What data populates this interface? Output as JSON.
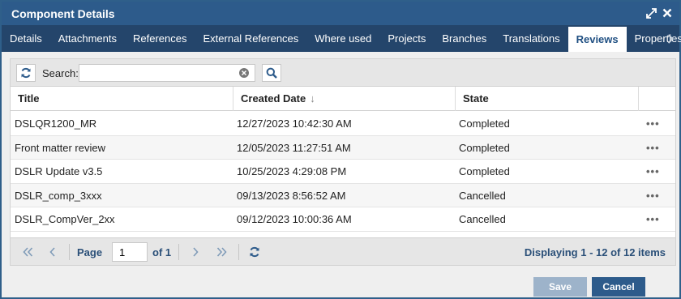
{
  "dialog": {
    "title": "Component Details"
  },
  "tabs": [
    {
      "label": "Details"
    },
    {
      "label": "Attachments"
    },
    {
      "label": "References"
    },
    {
      "label": "External References"
    },
    {
      "label": "Where used"
    },
    {
      "label": "Projects"
    },
    {
      "label": "Branches"
    },
    {
      "label": "Translations"
    },
    {
      "label": "Reviews",
      "active": true
    },
    {
      "label": "Properties"
    }
  ],
  "search": {
    "label": "Search:",
    "value": "",
    "placeholder": ""
  },
  "grid": {
    "columns": [
      "Title",
      "Created Date",
      "State",
      ""
    ],
    "sort_indicator": "↓",
    "rows": [
      {
        "title": "DSLQR1200_MR",
        "created": "12/27/2023 10:42:30 AM",
        "state": "Completed",
        "actions": "•••"
      },
      {
        "title": "Front matter review",
        "created": "12/05/2023 11:27:51 AM",
        "state": "Completed",
        "actions": "•••"
      },
      {
        "title": "DSLR Update v3.5",
        "created": "10/25/2023 4:29:08 PM",
        "state": "Completed",
        "actions": "•••"
      },
      {
        "title": "DSLR_comp_3xxx",
        "created": "09/13/2023 8:56:52 AM",
        "state": "Cancelled",
        "actions": "•••"
      },
      {
        "title": "DSLR_CompVer_2xx",
        "created": "09/12/2023 10:00:36 AM",
        "state": "Cancelled",
        "actions": "•••"
      }
    ]
  },
  "pager": {
    "page_label": "Page",
    "page_value": "1",
    "of_label": "of 1",
    "info": "Displaying 1 - 12 of 12 items"
  },
  "footer": {
    "save_label": "Save",
    "cancel_label": "Cancel"
  },
  "colors": {
    "titlebar": "#2d5b8b",
    "tabbar": "#24456b",
    "accent": "#2a4f78"
  }
}
